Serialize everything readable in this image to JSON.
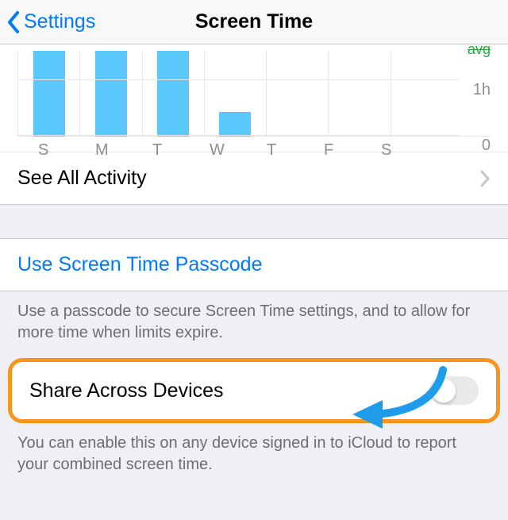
{
  "nav": {
    "back_label": "Settings",
    "title": "Screen Time"
  },
  "chart_data": {
    "type": "bar",
    "categories": [
      "S",
      "M",
      "T",
      "W",
      "T",
      "F",
      "S"
    ],
    "values": [
      1.55,
      1.55,
      1.55,
      0.45,
      0,
      0,
      0
    ],
    "ylim": [
      0,
      1.55
    ],
    "ticks": [
      {
        "v": 0,
        "label": "0"
      },
      {
        "v": 1,
        "label": "1h"
      }
    ],
    "avg_label": "avg"
  },
  "rows": {
    "see_all": "See All Activity",
    "passcode": "Use Screen Time Passcode",
    "passcode_footer": "Use a passcode to secure Screen Time settings, and to allow for more time when limits expire.",
    "share": "Share Across Devices",
    "share_state": "off",
    "share_footer": "You can enable this on any device signed in to iCloud to report your combined screen time."
  },
  "colors": {
    "bar": "#5ac8fa",
    "link": "#007aff",
    "highlight": "#f7941d",
    "arrow": "#1e9be9"
  }
}
